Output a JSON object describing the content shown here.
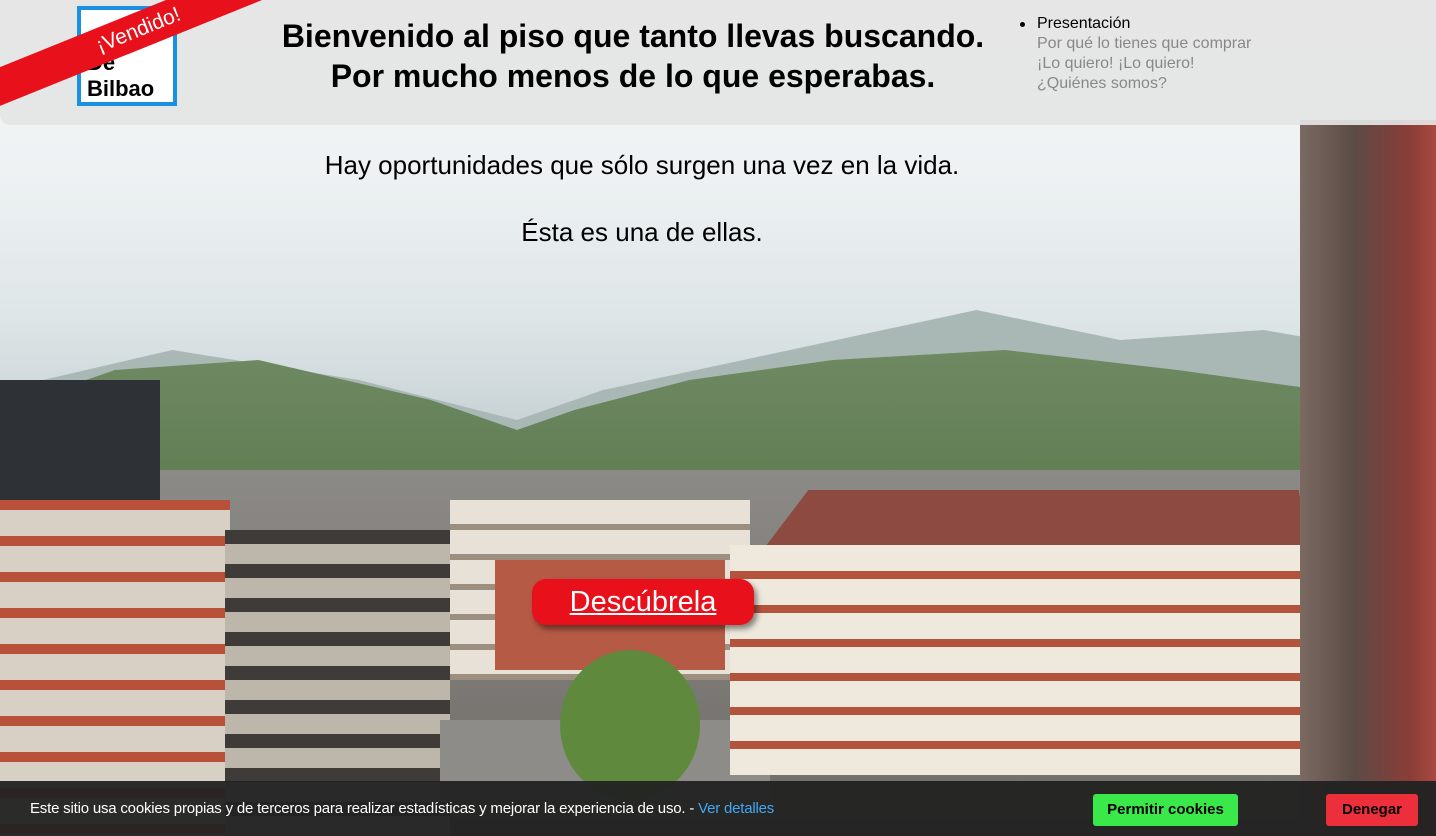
{
  "logo": {
    "line1": "",
    "line2": "De",
    "line3": "Bilbao",
    "ribbon": "¡Vendido!"
  },
  "header": {
    "title_line1": "Bienvenido al piso que tanto llevas buscando.",
    "title_line2": "Por mucho menos de lo que esperabas."
  },
  "nav": {
    "items": [
      {
        "label": "Presentación",
        "active": true
      },
      {
        "label": "Por qué lo tienes que comprar",
        "active": false
      },
      {
        "label": "¡Lo quiero! ¡Lo quiero!",
        "active": false
      },
      {
        "label": "¿Quiénes somos?",
        "active": false
      }
    ]
  },
  "intro": {
    "line1": "Hay oportunidades que sólo surgen una vez en la vida.",
    "line2": "Ésta es una de ellas."
  },
  "cta": {
    "label": "Descúbrela"
  },
  "cookie": {
    "text": "Este sitio usa cookies propias y de terceros para realizar estadísticas y mejorar la experiencia de uso. - ",
    "link": "Ver detalles",
    "allow_label": "Permitir cookies",
    "deny_label": "Denegar"
  },
  "colors": {
    "accent_red": "#e8101a",
    "logo_blue": "#1a90e2",
    "allow_green": "#3be84a",
    "deny_red": "#ed2f3c",
    "link_blue": "#3fa9f5"
  }
}
